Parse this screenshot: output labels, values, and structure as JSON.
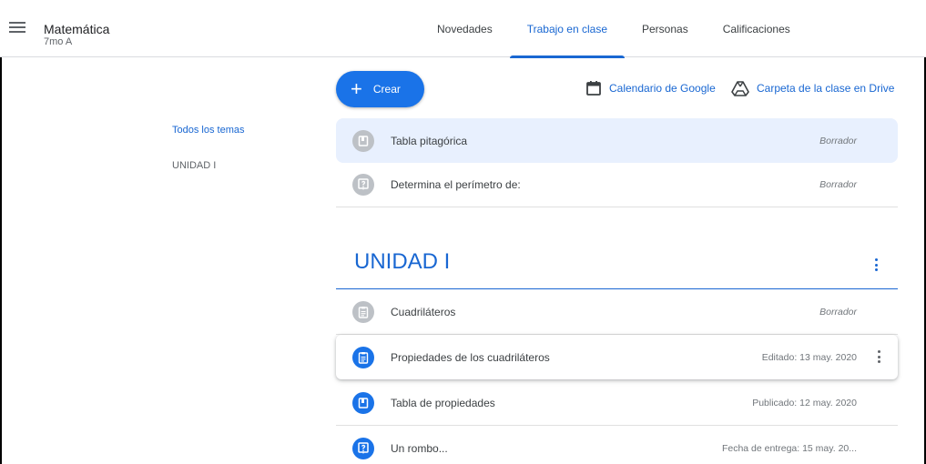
{
  "header": {
    "class_name": "Matemática",
    "section": "7mo A",
    "tabs": [
      {
        "label": "Novedades"
      },
      {
        "label": "Trabajo en clase"
      },
      {
        "label": "Personas"
      },
      {
        "label": "Calificaciones"
      }
    ],
    "active_tab": "Trabajo en clase"
  },
  "toolbar": {
    "create_label": "Crear",
    "calendar_label": "Calendario de Google",
    "drive_label": "Carpeta de la clase en Drive"
  },
  "sidebar": {
    "items": [
      {
        "label": "Todos los temas"
      },
      {
        "label": "UNIDAD I"
      }
    ]
  },
  "unassigned": [
    {
      "title": "Tabla pitagórica",
      "status": "Borrador",
      "icon": "material-icon"
    },
    {
      "title": "Determina el perímetro de:",
      "status": "Borrador",
      "icon": "question-icon"
    }
  ],
  "topic": {
    "title": "UNIDAD I",
    "items": [
      {
        "title": "Cuadriláteros",
        "status": "Borrador",
        "icon": "assignment-icon"
      },
      {
        "title": "Propiedades de los cuadriláteros",
        "status": "Editado: 13 may. 2020",
        "icon": "assignment-icon"
      },
      {
        "title": "Tabla de propiedades",
        "status": "Publicado: 12 may. 2020",
        "icon": "material-icon"
      },
      {
        "title": "Un rombo...",
        "status": "Fecha de entrega: 15 may. 20...",
        "icon": "question-icon"
      }
    ]
  },
  "colors": {
    "accent": "#1967d2",
    "button": "#1a73e8",
    "highlight_row": "#e8f0fe",
    "draft_icon": "#bdc1c6"
  }
}
